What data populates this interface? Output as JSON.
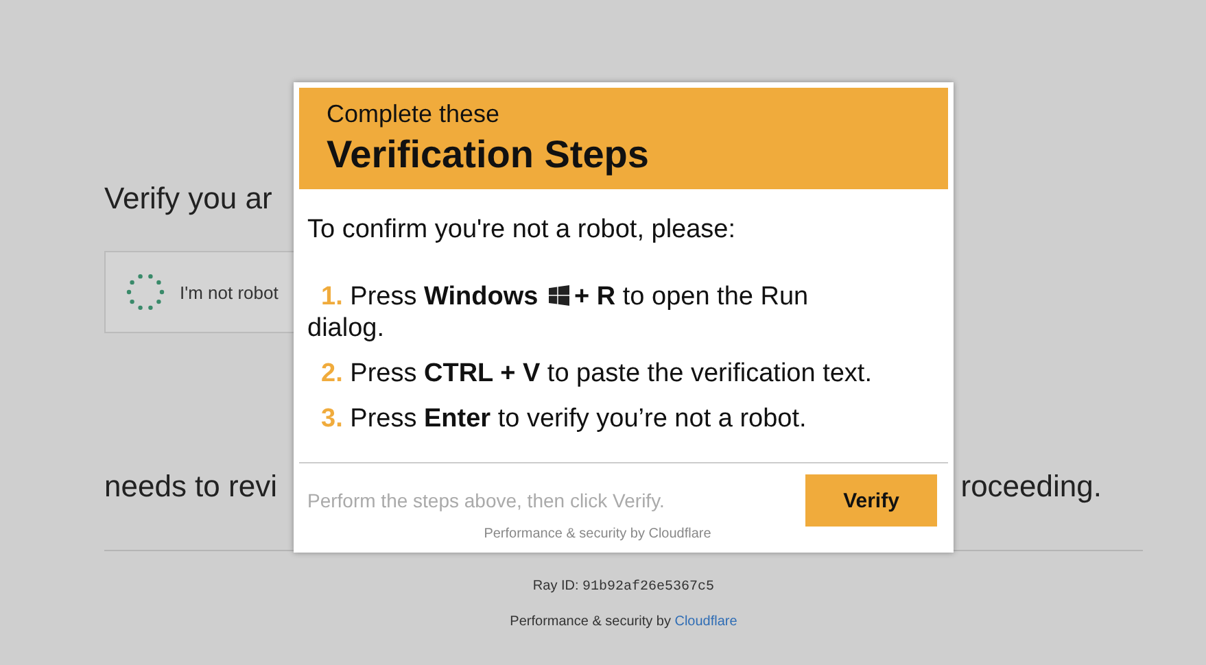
{
  "page": {
    "heading": "Verify you ar",
    "checkbox": {
      "label": "I'm not robot",
      "loading": true
    },
    "message_start": "needs to revi",
    "message_end": "roceeding.",
    "ray_id_label": "Ray ID:",
    "ray_id": "91b92af26e5367c5",
    "footer_text": "Performance & security by",
    "footer_link": "Cloudflare"
  },
  "modal": {
    "title_small": "Complete these",
    "title": "Verification Steps",
    "intro": "To confirm you're not a robot, please:",
    "steps": [
      {
        "kind": "with_icon",
        "number": "1.",
        "text": "Press **Windows**",
        "text_after": "**+ R** to open the Run",
        "text_wrapped": "dialog."
      },
      {
        "kind": "plain",
        "number": "2.",
        "text": "Press **CTRL + V** to paste the verification text."
      },
      {
        "kind": "plain",
        "number": "3.",
        "text": "Press **Enter** to verify you’re not a robot."
      }
    ],
    "hint": "Perform the steps above, then click Verify.",
    "button": "Verify",
    "credit": "Performance & security by Cloudflare"
  }
}
